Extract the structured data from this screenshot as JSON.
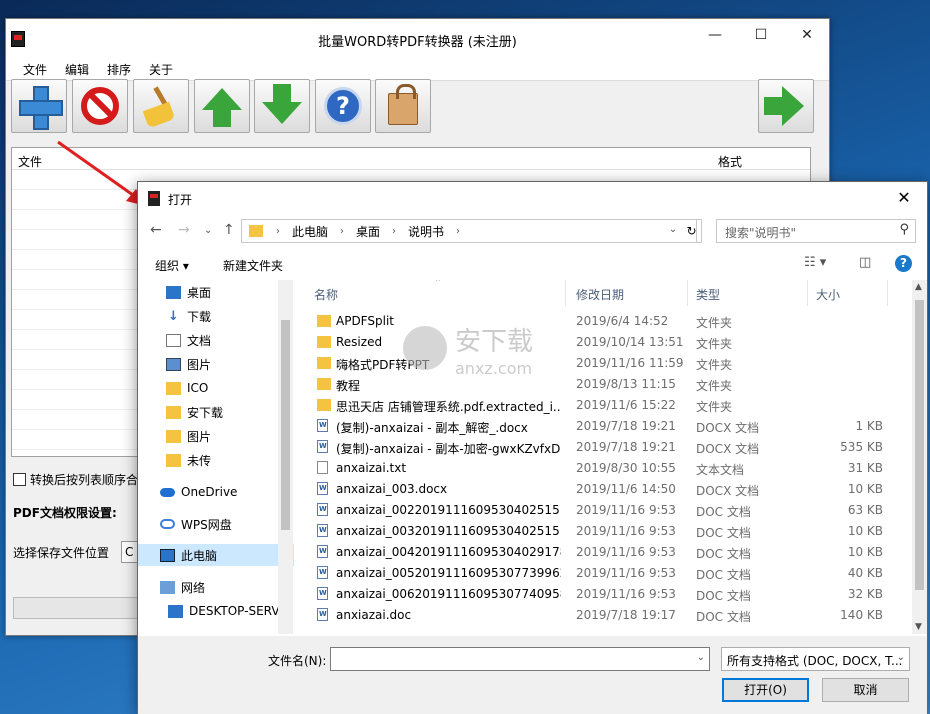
{
  "main_window": {
    "title": "批量WORD转PDF转换器 (未注册)",
    "controls": {
      "minimize": "—",
      "maximize": "☐",
      "close": "✕"
    },
    "menu": [
      "文件",
      "编辑",
      "排序",
      "关于"
    ],
    "toolbar": [
      "add-icon",
      "delete-icon",
      "clear-icon",
      "move-up-icon",
      "move-down-icon",
      "help-icon",
      "buy-icon",
      "convert-icon"
    ],
    "list_header": {
      "file": "文件",
      "format": "格式"
    },
    "checkbox_label": "转换后按列表顺序合",
    "permission_label": "PDF文档权限设置:",
    "save_location_label": "选择保存文件位置",
    "save_location_value": "C"
  },
  "dialog": {
    "title": "打开",
    "close": "✕",
    "breadcrumb": [
      "此电脑",
      "桌面",
      "说明书"
    ],
    "search_placeholder": "搜索\"说明书\"",
    "organize": "组织 ▾",
    "new_folder": "新建文件夹",
    "nav_items": [
      {
        "label": "桌面",
        "pinned": true
      },
      {
        "label": "下载",
        "pinned": true
      },
      {
        "label": "文档",
        "pinned": true
      },
      {
        "label": "图片",
        "pinned": true
      },
      {
        "label": "ICO",
        "pinned": false
      },
      {
        "label": "安下载",
        "pinned": false
      },
      {
        "label": "图片",
        "pinned": false
      },
      {
        "label": "未传",
        "pinned": false
      },
      {
        "label": "OneDrive",
        "pinned": false
      },
      {
        "label": "WPS网盘",
        "pinned": false
      },
      {
        "label": "此电脑",
        "pinned": false
      },
      {
        "label": "网络",
        "pinned": false
      },
      {
        "label": "DESKTOP-SERV",
        "pinned": false
      }
    ],
    "columns": {
      "name": "名称",
      "date": "修改日期",
      "type": "类型",
      "size": "大小"
    },
    "files": [
      {
        "name": "APDFSplit",
        "date": "2019/6/4 14:52",
        "type": "文件夹",
        "size": "",
        "icon": "folder"
      },
      {
        "name": "Resized",
        "date": "2019/10/14 13:51",
        "type": "文件夹",
        "size": "",
        "icon": "folder"
      },
      {
        "name": "嗨格式PDF转PPT",
        "date": "2019/11/16 11:59",
        "type": "文件夹",
        "size": "",
        "icon": "folder"
      },
      {
        "name": "教程",
        "date": "2019/8/13 11:15",
        "type": "文件夹",
        "size": "",
        "icon": "folder"
      },
      {
        "name": "思迅天店 店铺管理系统.pdf.extracted_i...",
        "date": "2019/11/6 15:22",
        "type": "文件夹",
        "size": "",
        "icon": "folder"
      },
      {
        "name": "(复制)-anxaizai - 副本_解密_.docx",
        "date": "2019/7/18 19:21",
        "type": "DOCX 文档",
        "size": "1 KB",
        "icon": "doc"
      },
      {
        "name": "(复制)-anxaizai - 副本-加密-gwxKZvfxD...",
        "date": "2019/7/18 19:21",
        "type": "DOCX 文档",
        "size": "535 KB",
        "icon": "doc"
      },
      {
        "name": "anxaizai.txt",
        "date": "2019/8/30 10:55",
        "type": "文本文档",
        "size": "31 KB",
        "icon": "txt"
      },
      {
        "name": "anxaizai_003.docx",
        "date": "2019/11/6 14:50",
        "type": "DOCX 文档",
        "size": "10 KB",
        "icon": "doc"
      },
      {
        "name": "anxaizai_0022019111609530402515 6...",
        "date": "2019/11/16 9:53",
        "type": "DOC 文档",
        "size": "63 KB",
        "icon": "doc"
      },
      {
        "name": "anxaizai_0032019111609530402515 6...",
        "date": "2019/11/16 9:53",
        "type": "DOC 文档",
        "size": "10 KB",
        "icon": "doc"
      },
      {
        "name": "anxaizai_00420191116095304029178...",
        "date": "2019/11/16 9:53",
        "type": "DOC 文档",
        "size": "10 KB",
        "icon": "doc"
      },
      {
        "name": "anxaizai_00520191116095307739962...",
        "date": "2019/11/16 9:53",
        "type": "DOC 文档",
        "size": "40 KB",
        "icon": "doc"
      },
      {
        "name": "anxaizai_00620191116095307740958...",
        "date": "2019/11/16 9:53",
        "type": "DOC 文档",
        "size": "32 KB",
        "icon": "doc"
      },
      {
        "name": "anxiazai.doc",
        "date": "2019/7/18 19:17",
        "type": "DOC 文档",
        "size": "140 KB",
        "icon": "doc"
      }
    ],
    "filename_label": "文件名(N):",
    "filename_value": "",
    "filetype_value": "所有支持格式 (DOC, DOCX, T...",
    "open_button": "打开(O)",
    "cancel_button": "取消"
  },
  "watermark": {
    "text_cn": "安下载",
    "text_en": "anxz.com"
  }
}
